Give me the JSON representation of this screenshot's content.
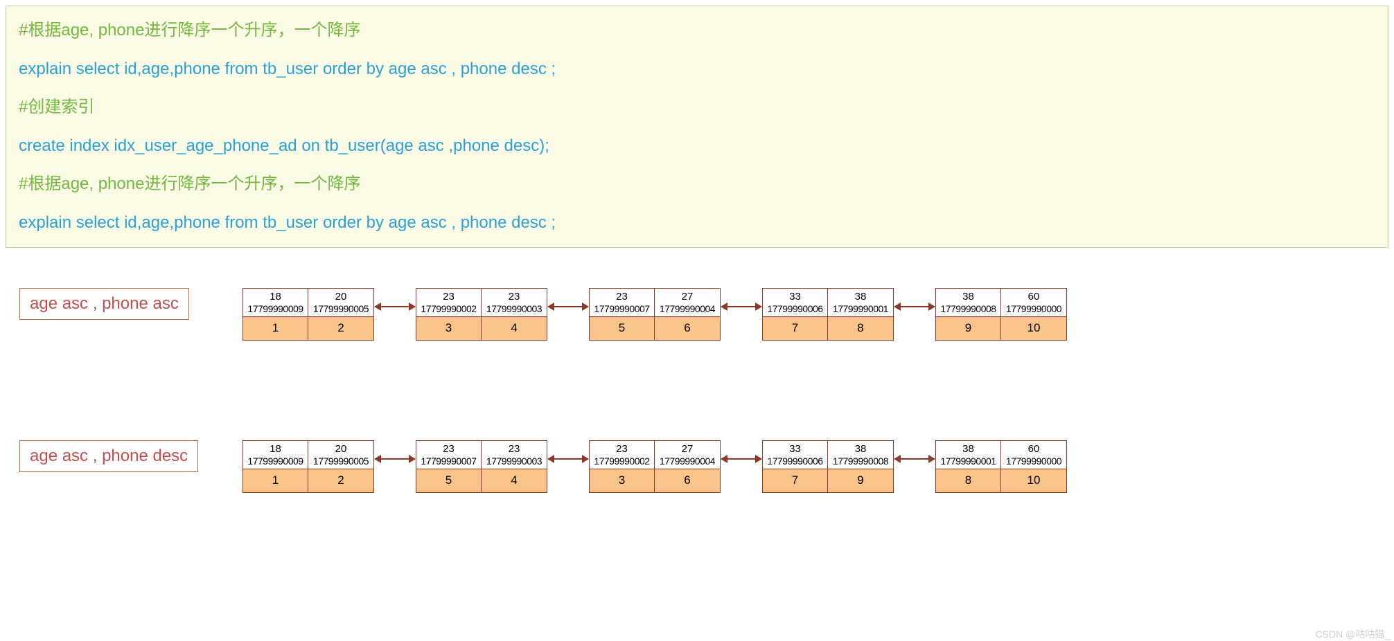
{
  "code": {
    "l1": "#根据age, phone进行降序一个升序，一个降序",
    "l2": "explain select  id,age,phone from tb_user order by age asc , phone  desc ;",
    "l3": "#创建索引",
    "l4": "create  index  idx_user_age_phone_ad  on  tb_user(age asc ,phone desc);",
    "l5": "#根据age, phone进行降序一个升序，一个降序",
    "l6": "explain select  id,age,phone from tb_user order by age asc , phone  desc ;"
  },
  "labels": {
    "r1": "age asc , phone  asc",
    "r2": "age asc , phone  desc"
  },
  "row1": [
    [
      {
        "age": "18",
        "phone": "17799990009",
        "id": "1"
      },
      {
        "age": "20",
        "phone": "17799990005",
        "id": "2"
      }
    ],
    [
      {
        "age": "23",
        "phone": "17799990002",
        "id": "3"
      },
      {
        "age": "23",
        "phone": "17799990003",
        "id": "4"
      }
    ],
    [
      {
        "age": "23",
        "phone": "17799990007",
        "id": "5"
      },
      {
        "age": "27",
        "phone": "17799990004",
        "id": "6"
      }
    ],
    [
      {
        "age": "33",
        "phone": "17799990006",
        "id": "7"
      },
      {
        "age": "38",
        "phone": "17799990001",
        "id": "8"
      }
    ],
    [
      {
        "age": "38",
        "phone": "17799990008",
        "id": "9"
      },
      {
        "age": "60",
        "phone": "17799990000",
        "id": "10"
      }
    ]
  ],
  "row2": [
    [
      {
        "age": "18",
        "phone": "17799990009",
        "id": "1"
      },
      {
        "age": "20",
        "phone": "17799990005",
        "id": "2"
      }
    ],
    [
      {
        "age": "23",
        "phone": "17799990007",
        "id": "5"
      },
      {
        "age": "23",
        "phone": "17799990003",
        "id": "4"
      }
    ],
    [
      {
        "age": "23",
        "phone": "17799990002",
        "id": "3"
      },
      {
        "age": "27",
        "phone": "17799990004",
        "id": "6"
      }
    ],
    [
      {
        "age": "33",
        "phone": "17799990006",
        "id": "7"
      },
      {
        "age": "38",
        "phone": "17799990008",
        "id": "9"
      }
    ],
    [
      {
        "age": "38",
        "phone": "17799990001",
        "id": "8"
      },
      {
        "age": "60",
        "phone": "17799990000",
        "id": "10"
      }
    ]
  ],
  "layout": {
    "pairLefts": [
      330,
      580,
      830,
      1080,
      1330
    ],
    "linkWidth": 58,
    "tagTop": 15,
    "pairTop": 0,
    "linkTop": 26
  },
  "watermark": "CSDN @咕咕猫_"
}
